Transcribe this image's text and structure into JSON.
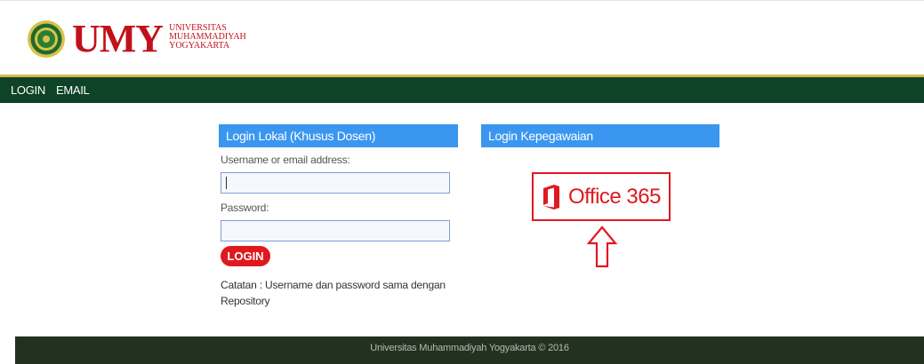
{
  "brand": {
    "name": "UMY",
    "university_lines": [
      "UNIVERSITAS",
      "MUHAMMADIYAH",
      "YOGYAKARTA"
    ]
  },
  "nav": {
    "items": [
      {
        "label": "LOGIN"
      },
      {
        "label": "EMAIL"
      }
    ]
  },
  "local_login": {
    "title": "Login Lokal (Khusus Dosen)",
    "username_label": "Username or email address:",
    "username_value": "",
    "password_label": "Password:",
    "password_value": "",
    "login_button": "LOGIN",
    "note": "Catatan : Username dan password sama dengan Repository"
  },
  "staff_login": {
    "title": "Login Kepegawaian",
    "office_label": "Office 365"
  },
  "footer": {
    "text": "Universitas Muhammadiyah Yogyakarta © 2016"
  },
  "colors": {
    "nav_bg": "#0e4327",
    "panel_head": "#3b96f0",
    "accent_red": "#e0191f",
    "footer_bg": "#23311f"
  }
}
